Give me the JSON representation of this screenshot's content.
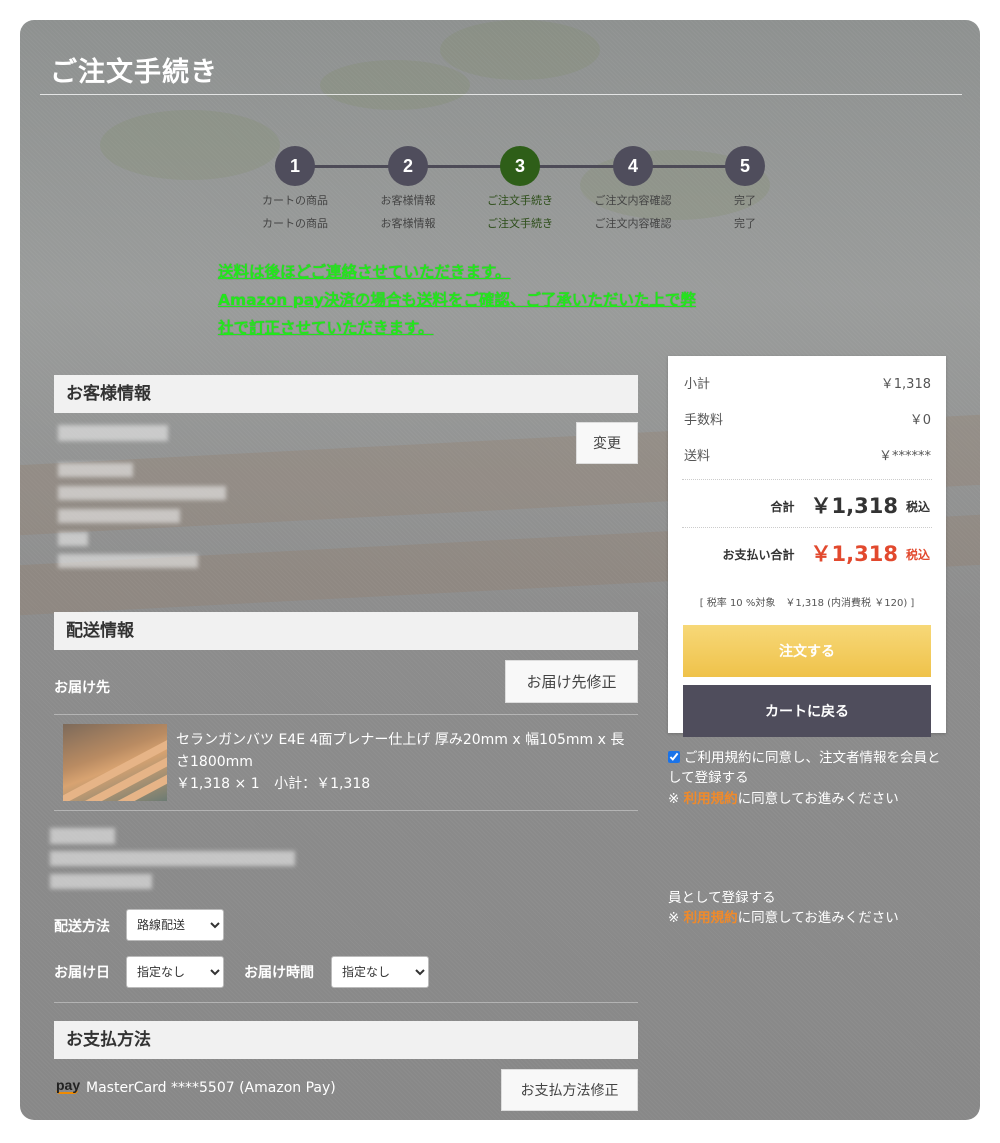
{
  "page": {
    "title": "ご注文手続き"
  },
  "steps": [
    {
      "number": "1",
      "label": "カートの商品"
    },
    {
      "number": "2",
      "label": "お客様情報"
    },
    {
      "number": "3",
      "label": "ご注文手続き"
    },
    {
      "number": "4",
      "label": "ご注文内容確認"
    },
    {
      "number": "5",
      "label": "完了"
    }
  ],
  "notice": {
    "line1": "送料は後ほどご連絡させていただきます。",
    "line2": "Amazon pay決済の場合も送料をご確認、ご了承いただいた上で弊",
    "line3": "社で訂正させていただきます。"
  },
  "customer": {
    "header": "お客様情報",
    "change_button": "変更"
  },
  "delivery": {
    "header": "配送情報",
    "destination_label": "お届け先",
    "edit_button": "お届け先修正",
    "product": {
      "name": "セランガンバツ E4E 4面プレナー仕上げ 厚み20mm x 幅105mm x 長さ1800mm",
      "price_qty": "￥1,318 × 1",
      "subtotal": "小計：￥1,318"
    },
    "method_label": "配送方法",
    "method_value": "路線配送",
    "date_label": "お届け日",
    "date_value": "指定なし",
    "time_label": "お届け時間",
    "time_value": "指定なし"
  },
  "payment": {
    "header": "お支払方法",
    "logo_text": "pay",
    "method": "MasterCard ****5507 (Amazon Pay)",
    "edit_button": "お支払方法修正"
  },
  "summary": {
    "subtotal_label": "小計",
    "subtotal_value": "￥1,318",
    "fee_label": "手数料",
    "fee_value": "￥0",
    "shipping_label": "送料",
    "shipping_value": "￥******",
    "total_label": "合計",
    "total_value": "￥1,318",
    "total_tax": "税込",
    "payment_total_label": "お支払い合計",
    "payment_total_value": "￥1,318",
    "payment_total_tax": "税込",
    "tax_note": "[ 税率 10 %対象　￥1,318 (内消費税 ￥120) ]",
    "order_button": "注文する",
    "back_button": "カートに戻る"
  },
  "agreement": {
    "checked": true,
    "text": "ご利用規約に同意し、注文者情報を会員として登録する",
    "note_prefix": "※ ",
    "terms_link": "利用規約",
    "note_suffix": "に同意してお進みください",
    "ghost_text": "員として登録する"
  }
}
